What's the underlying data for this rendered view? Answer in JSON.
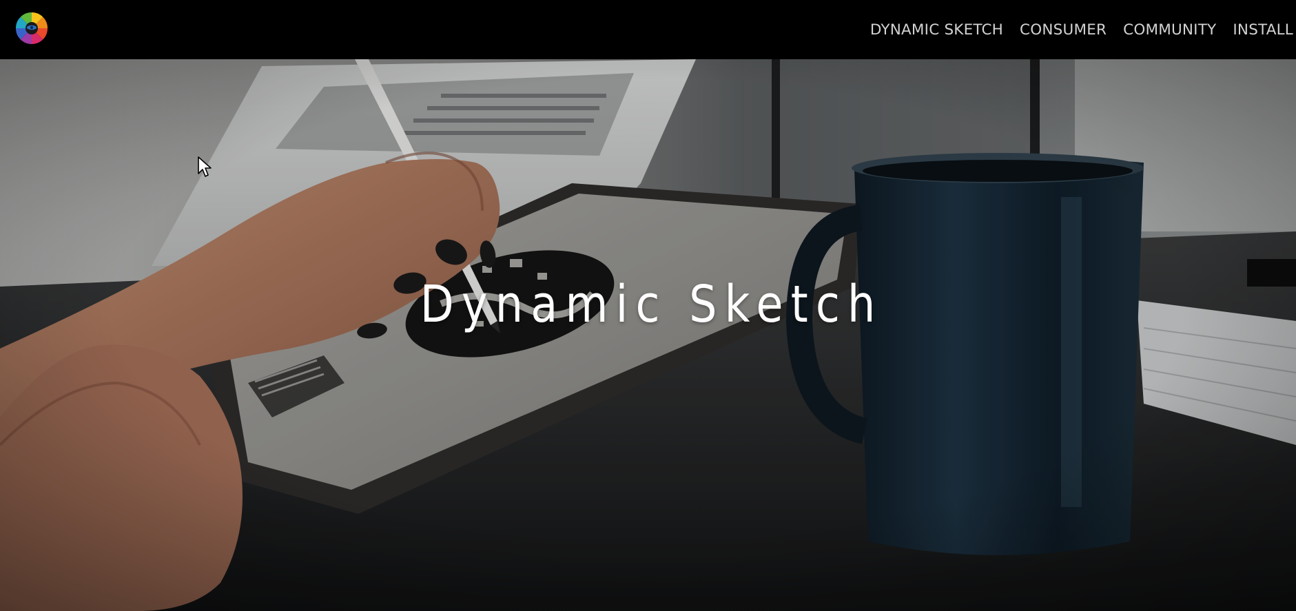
{
  "logo": {
    "icon": "color-wheel-logo"
  },
  "nav": {
    "items": [
      {
        "label": "DYNAMIC SKETCH"
      },
      {
        "label": "CONSUMER"
      },
      {
        "label": "COMMUNITY"
      },
      {
        "label": "INSTALL"
      }
    ]
  },
  "hero": {
    "title": "Dynamic Sketch",
    "background_description_icon": "hand-drawing-on-tablet-photo"
  },
  "colors": {
    "topbar": "#000000",
    "nav_text": "#d2d2d2",
    "hero_title": "#ffffff"
  }
}
